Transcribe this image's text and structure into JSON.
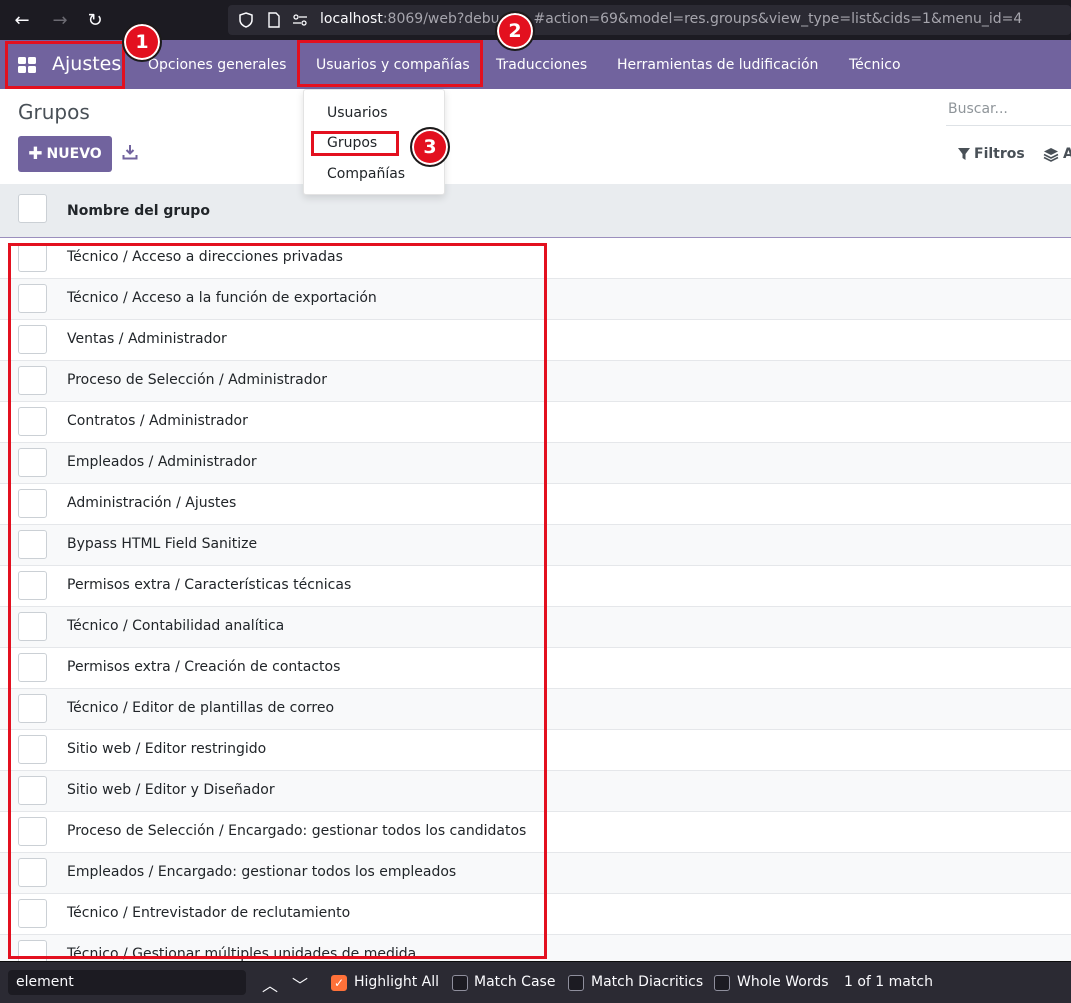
{
  "browser": {
    "url_host": "localhost",
    "url_rest": ":8069/web?debu",
    "url_tail": "#action=69&model=res.groups&view_type=list&cids=1&menu_id=4"
  },
  "navbar": {
    "brand": "Ajustes",
    "menus": [
      "Opciones generales",
      "Usuarios y compañías",
      "Traducciones",
      "Herramientas de ludificación",
      "Técnico"
    ]
  },
  "dropdown": {
    "items": [
      "Usuarios",
      "Grupos",
      "Compañías"
    ]
  },
  "control_panel": {
    "title": "Grupos",
    "new_button": "NUEVO",
    "search_placeholder": "Buscar...",
    "filters": "Filtros",
    "group_by": "A"
  },
  "table": {
    "column_header": "Nombre del grupo",
    "rows": [
      "Técnico / Acceso a direcciones privadas",
      "Técnico / Acceso a la función de exportación",
      "Ventas / Administrador",
      "Proceso de Selección / Administrador",
      "Contratos / Administrador",
      "Empleados / Administrador",
      "Administración / Ajustes",
      "Bypass HTML Field Sanitize",
      "Permisos extra / Características técnicas",
      "Técnico / Contabilidad analítica",
      "Permisos extra / Creación de contactos",
      "Técnico / Editor de plantillas de correo",
      "Sitio web / Editor restringido",
      "Sitio web / Editor y Diseñador",
      "Proceso de Selección / Encargado: gestionar todos los candidatos",
      "Empleados / Encargado: gestionar todos los empleados",
      "Técnico / Entrevistador de reclutamiento",
      "Técnico / Gestionar múltiples unidades de medida"
    ]
  },
  "annotations": {
    "badges": [
      "1",
      "2",
      "3"
    ]
  },
  "findbar": {
    "query": "element",
    "highlight_all": "Highlight All",
    "match_case": "Match Case",
    "match_diacritics": "Match Diacritics",
    "whole_words": "Whole Words",
    "result": "1 of 1 match"
  },
  "colors": {
    "brand": "#71639e",
    "annotation": "#e3101f",
    "checkbox_on": "#ff7139"
  }
}
